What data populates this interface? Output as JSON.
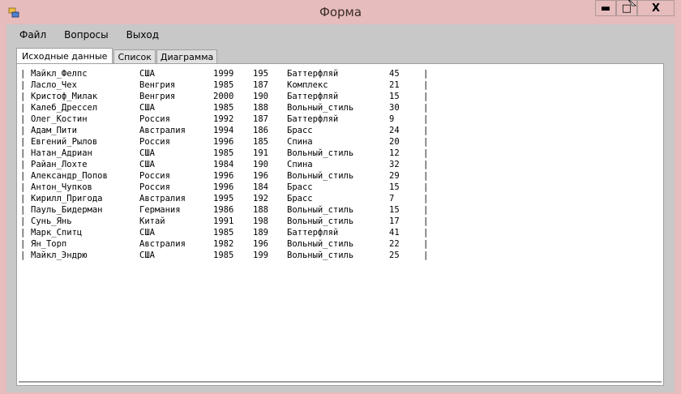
{
  "window": {
    "title": "Форма",
    "icons": {
      "app": "app-icon",
      "minimize": "minimize-icon",
      "maximize": "maximize-icon",
      "close": "close-icon"
    },
    "caption_buttons": {
      "minimize": "▬",
      "maximize": "□",
      "close": "X"
    }
  },
  "menu": {
    "items": [
      "Файл",
      "Вопросы",
      "Выход"
    ]
  },
  "tabs": [
    {
      "label": "Исходные данные",
      "active": true
    },
    {
      "label": "Список",
      "active": false
    },
    {
      "label": "Диаграмма",
      "active": false
    }
  ],
  "table": {
    "separator": "|",
    "rows": [
      {
        "name": "Майкл_Фелпс",
        "country": "США",
        "year": "1999",
        "height": "195",
        "style": "Баттерфляй",
        "score": "45"
      },
      {
        "name": "Ласло_Чех",
        "country": "Венгрия",
        "year": "1985",
        "height": "187",
        "style": "Комплекс",
        "score": "21"
      },
      {
        "name": "Кристоф_Милак",
        "country": "Венгрия",
        "year": "2000",
        "height": "190",
        "style": "Баттерфляй",
        "score": "15"
      },
      {
        "name": "Калеб_Дрессел",
        "country": "США",
        "year": "1985",
        "height": "188",
        "style": "Вольный_стиль",
        "score": "30"
      },
      {
        "name": "Олег_Костин",
        "country": "Россия",
        "year": "1992",
        "height": "187",
        "style": "Баттерфляй",
        "score": "9"
      },
      {
        "name": "Адам_Пити",
        "country": "Австралия",
        "year": "1994",
        "height": "186",
        "style": "Брасс",
        "score": "24"
      },
      {
        "name": "Евгений_Рылов",
        "country": "Россия",
        "year": "1996",
        "height": "185",
        "style": "Спина",
        "score": "20"
      },
      {
        "name": "Натан_Адриан",
        "country": "США",
        "year": "1985",
        "height": "191",
        "style": "Вольный_стиль",
        "score": "12"
      },
      {
        "name": "Райан_Лохте",
        "country": "США",
        "year": "1984",
        "height": "190",
        "style": "Спина",
        "score": "32"
      },
      {
        "name": "Александр_Попов",
        "country": "Россия",
        "year": "1996",
        "height": "196",
        "style": "Вольный_стиль",
        "score": "29"
      },
      {
        "name": "Антон_Чупков",
        "country": "Россия",
        "year": "1996",
        "height": "184",
        "style": "Брасс",
        "score": "15"
      },
      {
        "name": "Кирилл_Пригода",
        "country": "Австралия",
        "year": "1995",
        "height": "192",
        "style": "Брасс",
        "score": "7"
      },
      {
        "name": "Пауль_Бидерман",
        "country": "Германия",
        "year": "1986",
        "height": "188",
        "style": "Вольный_стиль",
        "score": "15"
      },
      {
        "name": "Сунь_Янь",
        "country": "Китай",
        "year": "1991",
        "height": "198",
        "style": "Вольный_стиль",
        "score": "17"
      },
      {
        "name": "Марк_Спитц",
        "country": "США",
        "year": "1985",
        "height": "189",
        "style": "Баттерфляй",
        "score": "41"
      },
      {
        "name": "Ян_Торп",
        "country": "Австралия",
        "year": "1982",
        "height": "196",
        "style": "Вольный_стиль",
        "score": "22"
      },
      {
        "name": "Майкл_Эндрю",
        "country": "США",
        "year": "1985",
        "height": "199",
        "style": "Вольный_стиль",
        "score": "25"
      }
    ]
  }
}
